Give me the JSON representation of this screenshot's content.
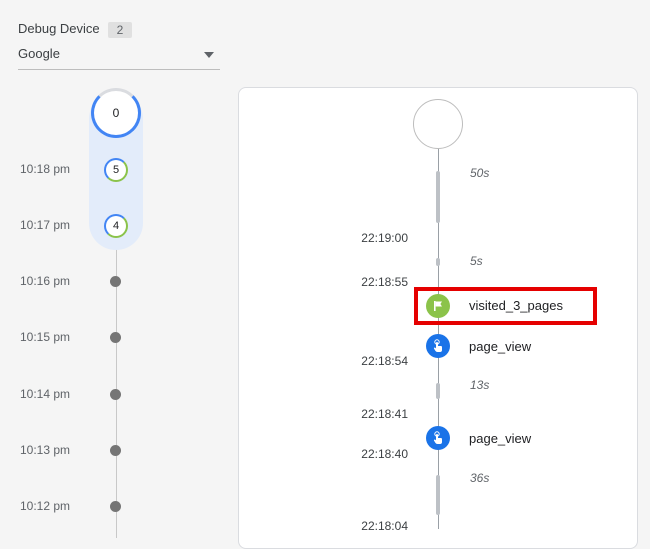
{
  "device": {
    "title": "Debug Device",
    "count": "2",
    "selected": "Google"
  },
  "minutes": {
    "top_count": "0",
    "rows": [
      {
        "time": "10:18 pm",
        "count": "5"
      },
      {
        "time": "10:17 pm",
        "count": "4"
      },
      {
        "time": "10:16 pm"
      },
      {
        "time": "10:15 pm"
      },
      {
        "time": "10:14 pm"
      },
      {
        "time": "10:13 pm"
      },
      {
        "time": "10:12 pm"
      }
    ]
  },
  "timeline": {
    "gaps": [
      "50s",
      "5s",
      "13s",
      "36s"
    ],
    "times": [
      "22:19:00",
      "22:18:55",
      "22:18:54",
      "22:18:41",
      "22:18:40",
      "22:18:04"
    ],
    "events": [
      {
        "name": "visited_3_pages",
        "icon": "flag-icon",
        "color": "#8bc34a"
      },
      {
        "name": "page_view",
        "icon": "touch-pointer-icon",
        "color": "#1a73e8"
      },
      {
        "name": "page_view",
        "icon": "touch-pointer-icon",
        "color": "#1a73e8"
      }
    ]
  },
  "colors": {
    "accent": "#4285f4",
    "highlight": "#e50000"
  }
}
